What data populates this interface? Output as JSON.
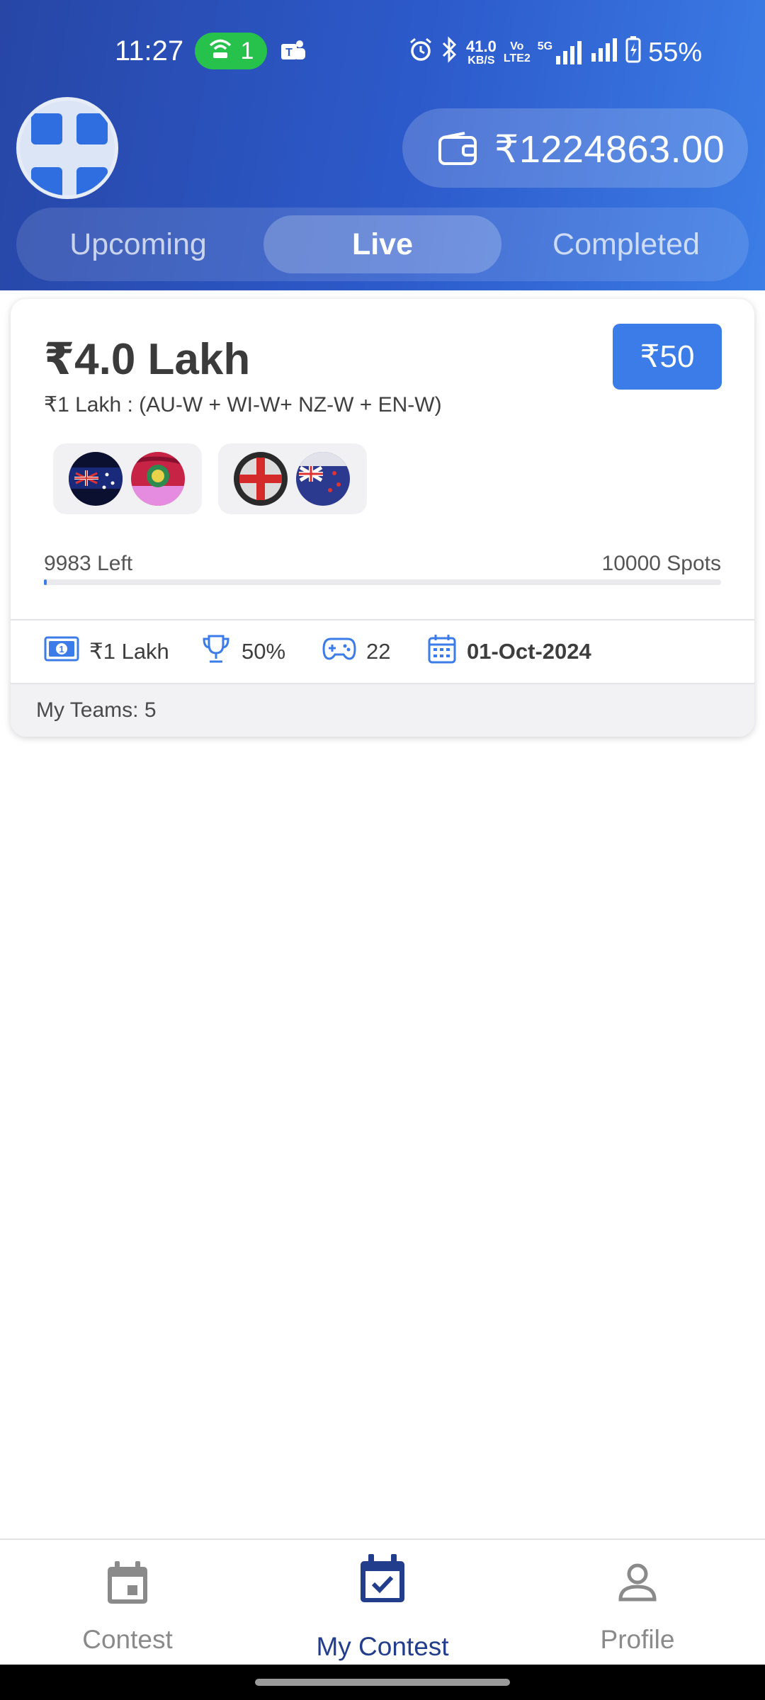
{
  "status_bar": {
    "time": "11:27",
    "hotspot_count": "1",
    "network_speed_value": "41.0",
    "network_speed_unit": "KB/S",
    "volte_top": "Vo",
    "volte_bottom": "LTE2",
    "network_type": "5G",
    "battery": "55%"
  },
  "header": {
    "wallet_amount": "₹1224863.00",
    "tabs": [
      {
        "label": "Upcoming",
        "active": false
      },
      {
        "label": "Live",
        "active": true
      },
      {
        "label": "Completed",
        "active": false
      }
    ]
  },
  "contest_card": {
    "prize_pool": "₹4.0 Lakh",
    "entry_fee": "₹50",
    "subtitle": "₹1 Lakh  : (AU-W + WI-W+ NZ-W + EN-W)",
    "spots_left": "9983 Left",
    "total_spots": "10000 Spots",
    "fill_fraction": 0.0017,
    "stats": {
      "first_prize": "₹1 Lakh",
      "winners_pct": "50%",
      "games": "22",
      "date": "01-Oct-2024"
    },
    "my_teams": "My Teams: 5",
    "matches": [
      {
        "team_a_icon": "australia-flag-icon",
        "team_b_icon": "west-indies-flag-icon"
      },
      {
        "team_a_icon": "england-flag-icon",
        "team_b_icon": "new-zealand-flag-icon"
      }
    ]
  },
  "bottom_nav": {
    "items": [
      {
        "label": "Contest",
        "icon": "calendar-icon"
      },
      {
        "label": "My Contest",
        "icon": "calendar-check-icon",
        "active": true
      },
      {
        "label": "Profile",
        "icon": "person-icon"
      }
    ]
  },
  "colors": {
    "accent": "#3b7ce8",
    "header_dark": "#2746a6",
    "nav_active": "#223d8c"
  }
}
